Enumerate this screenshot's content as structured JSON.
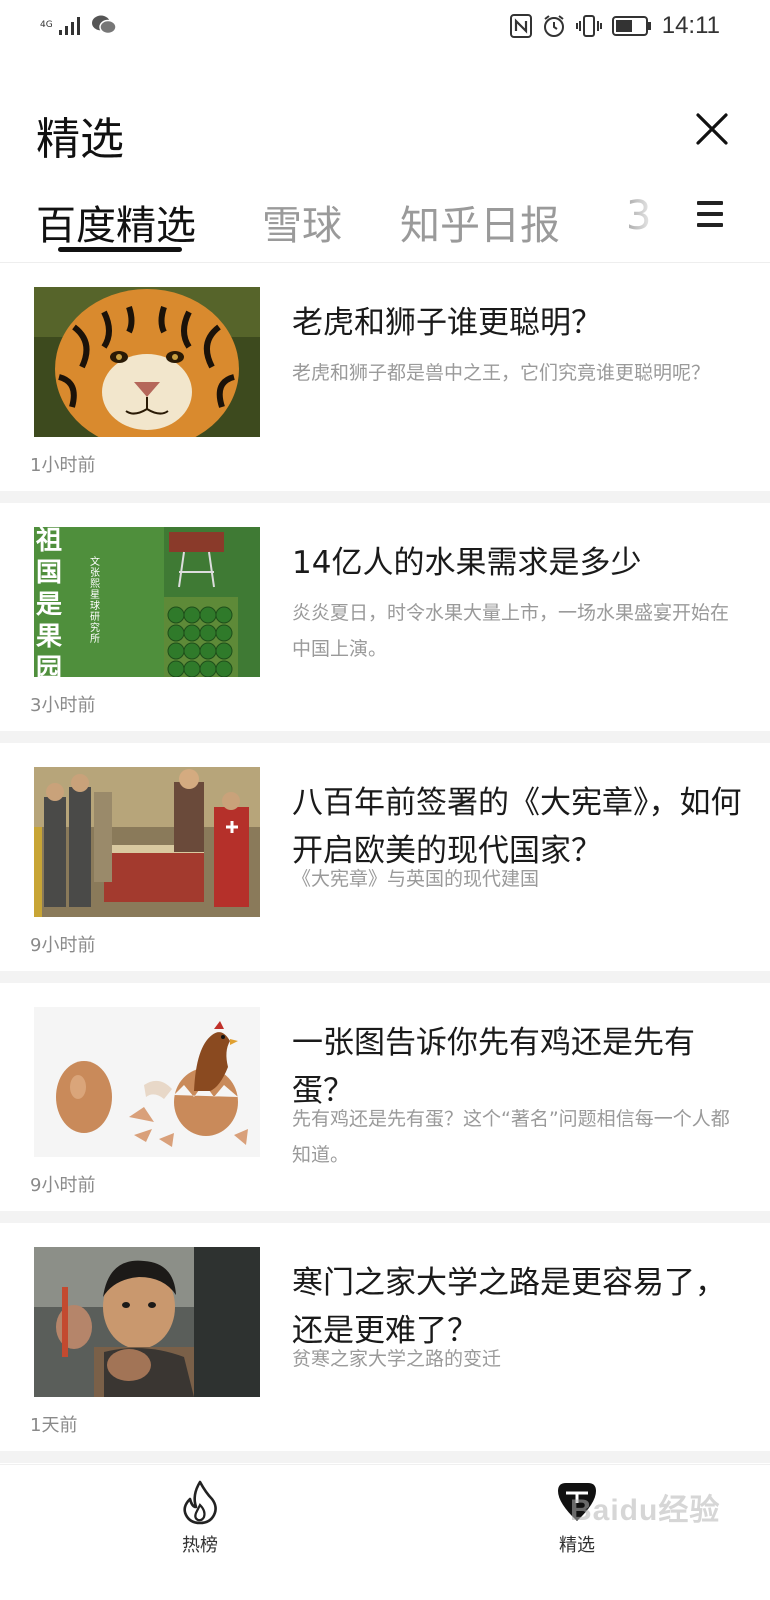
{
  "status_bar": {
    "network": "4G",
    "time": "14:11"
  },
  "header": {
    "title": "精选"
  },
  "tabs": [
    {
      "label": "百度精选",
      "active": true
    },
    {
      "label": "雪球",
      "active": false
    },
    {
      "label": "知乎日报",
      "active": false
    },
    {
      "label": "3",
      "active": false
    }
  ],
  "articles": [
    {
      "title": "老虎和狮子谁更聪明？",
      "desc": "老虎和狮子都是兽中之王，它们究竟谁更聪明呢？",
      "time": "1小时前",
      "image": "tiger"
    },
    {
      "title": "14亿人的水果需求是多少",
      "desc": "炎炎夏日，时令水果大量上市，一场水果盛宴开始在中国上演。",
      "time": "3小时前",
      "image": "fruit-field",
      "image_text": "祖国是果园",
      "image_subtext": "文 张熙 星球研究所"
    },
    {
      "title": "八百年前签署的《大宪章》，如何开启欧美的现代国家？",
      "desc": "《大宪章》与英国的现代建国",
      "time": "9小时前",
      "image": "magna-carta-painting"
    },
    {
      "title": "一张图告诉你先有鸡还是先有蛋？",
      "desc": "先有鸡还是先有蛋？这个“著名”问题相信每一个人都知道。",
      "time": "9小时前",
      "image": "egg-chicken"
    },
    {
      "title": "寒门之家大学之路是更容易了，还是更难了？",
      "desc": "贫寒之家大学之路的变迁",
      "time": "1天前",
      "image": "boy-photo"
    }
  ],
  "bottom_nav": [
    {
      "label": "热榜",
      "icon": "flame-icon"
    },
    {
      "label": "精选",
      "icon": "featured-icon"
    }
  ],
  "watermark": "Baidu经验"
}
